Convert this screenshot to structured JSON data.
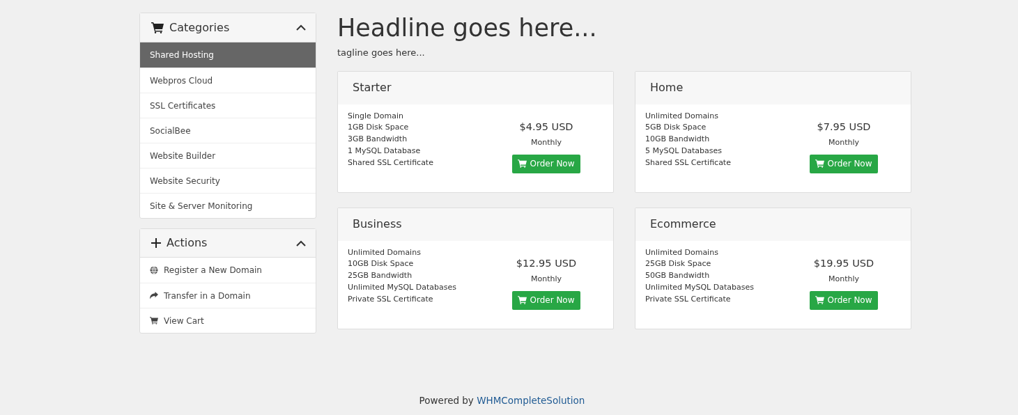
{
  "categories_panel": {
    "title": "Categories",
    "expanded": true,
    "items": [
      {
        "label": "Shared Hosting",
        "selected": true
      },
      {
        "label": "Webpros Cloud",
        "selected": false
      },
      {
        "label": "SSL Certificates",
        "selected": false
      },
      {
        "label": "SocialBee",
        "selected": false
      },
      {
        "label": "Website Builder",
        "selected": false
      },
      {
        "label": "Website Security",
        "selected": false
      },
      {
        "label": "Site & Server Monitoring",
        "selected": false
      }
    ]
  },
  "actions_panel": {
    "title": "Actions",
    "expanded": true,
    "items": [
      {
        "label": "Register a New Domain",
        "kind": "globe"
      },
      {
        "label": "Transfer in a Domain",
        "kind": "share"
      },
      {
        "label": "View Cart",
        "kind": "cart"
      }
    ]
  },
  "headline": "Headline goes here...",
  "tagline": "tagline goes here...",
  "products": [
    {
      "name": "Starter",
      "features": [
        "Single Domain",
        "1GB Disk Space",
        "3GB Bandwidth",
        "1 MySQL Database",
        "Shared SSL Certificate"
      ],
      "price": "$4.95 USD",
      "cycle": "Monthly",
      "button": "Order Now"
    },
    {
      "name": "Home",
      "features": [
        "Unlimited Domains",
        "5GB Disk Space",
        "10GB Bandwidth",
        "5 MySQL Databases",
        "Shared SSL Certificate"
      ],
      "price": "$7.95 USD",
      "cycle": "Monthly",
      "button": "Order Now"
    },
    {
      "name": "Business",
      "features": [
        "Unlimited Domains",
        "10GB Disk Space",
        "25GB Bandwidth",
        "Unlimited MySQL Databases",
        "Private SSL Certificate"
      ],
      "price": "$12.95 USD",
      "cycle": "Monthly",
      "button": "Order Now"
    },
    {
      "name": "Ecommerce",
      "features": [
        "Unlimited Domains",
        "25GB Disk Space",
        "50GB Bandwidth",
        "Unlimited MySQL Databases",
        "Private SSL Certificate"
      ],
      "price": "$19.95 USD",
      "cycle": "Monthly",
      "button": "Order Now"
    }
  ],
  "footer": {
    "text": "Powered by",
    "link": "WHMCompleteSolution"
  }
}
